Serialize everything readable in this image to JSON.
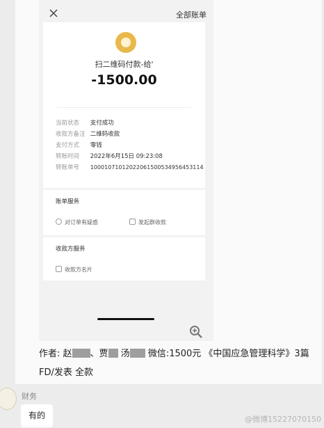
{
  "bill": {
    "close_label": "×",
    "all_bills": "全部账单",
    "merchant": "扫二维码付款-给'",
    "amount": "-1500.00",
    "details": [
      {
        "key": "当前状态",
        "value": "支付成功"
      },
      {
        "key": "收款方备注",
        "value": "二维码收款"
      },
      {
        "key": "支付方式",
        "value": "零钱"
      },
      {
        "key": "转账时间",
        "value": "2022年6月15日 09:23:08"
      },
      {
        "key": "转账单号",
        "value": "1000107101202206150053495645311​4"
      }
    ],
    "service_section": {
      "title": "账单服务",
      "item1": "对订单有疑惑",
      "item2": "发起群收款"
    },
    "payee_section": {
      "title": "收款方服务",
      "item1": "收款方名片"
    }
  },
  "caption": {
    "line1_prefix": "作者: 赵",
    "line1_mid": "、贾",
    "line1_mid2": "汤",
    "line1_rest": "微信:1500元 《中国应急管理科学》3篇",
    "line2": "FD/发表 全款"
  },
  "chat": {
    "sender": "财务",
    "reply": "有的"
  },
  "watermark": "@微博1522707​0150"
}
